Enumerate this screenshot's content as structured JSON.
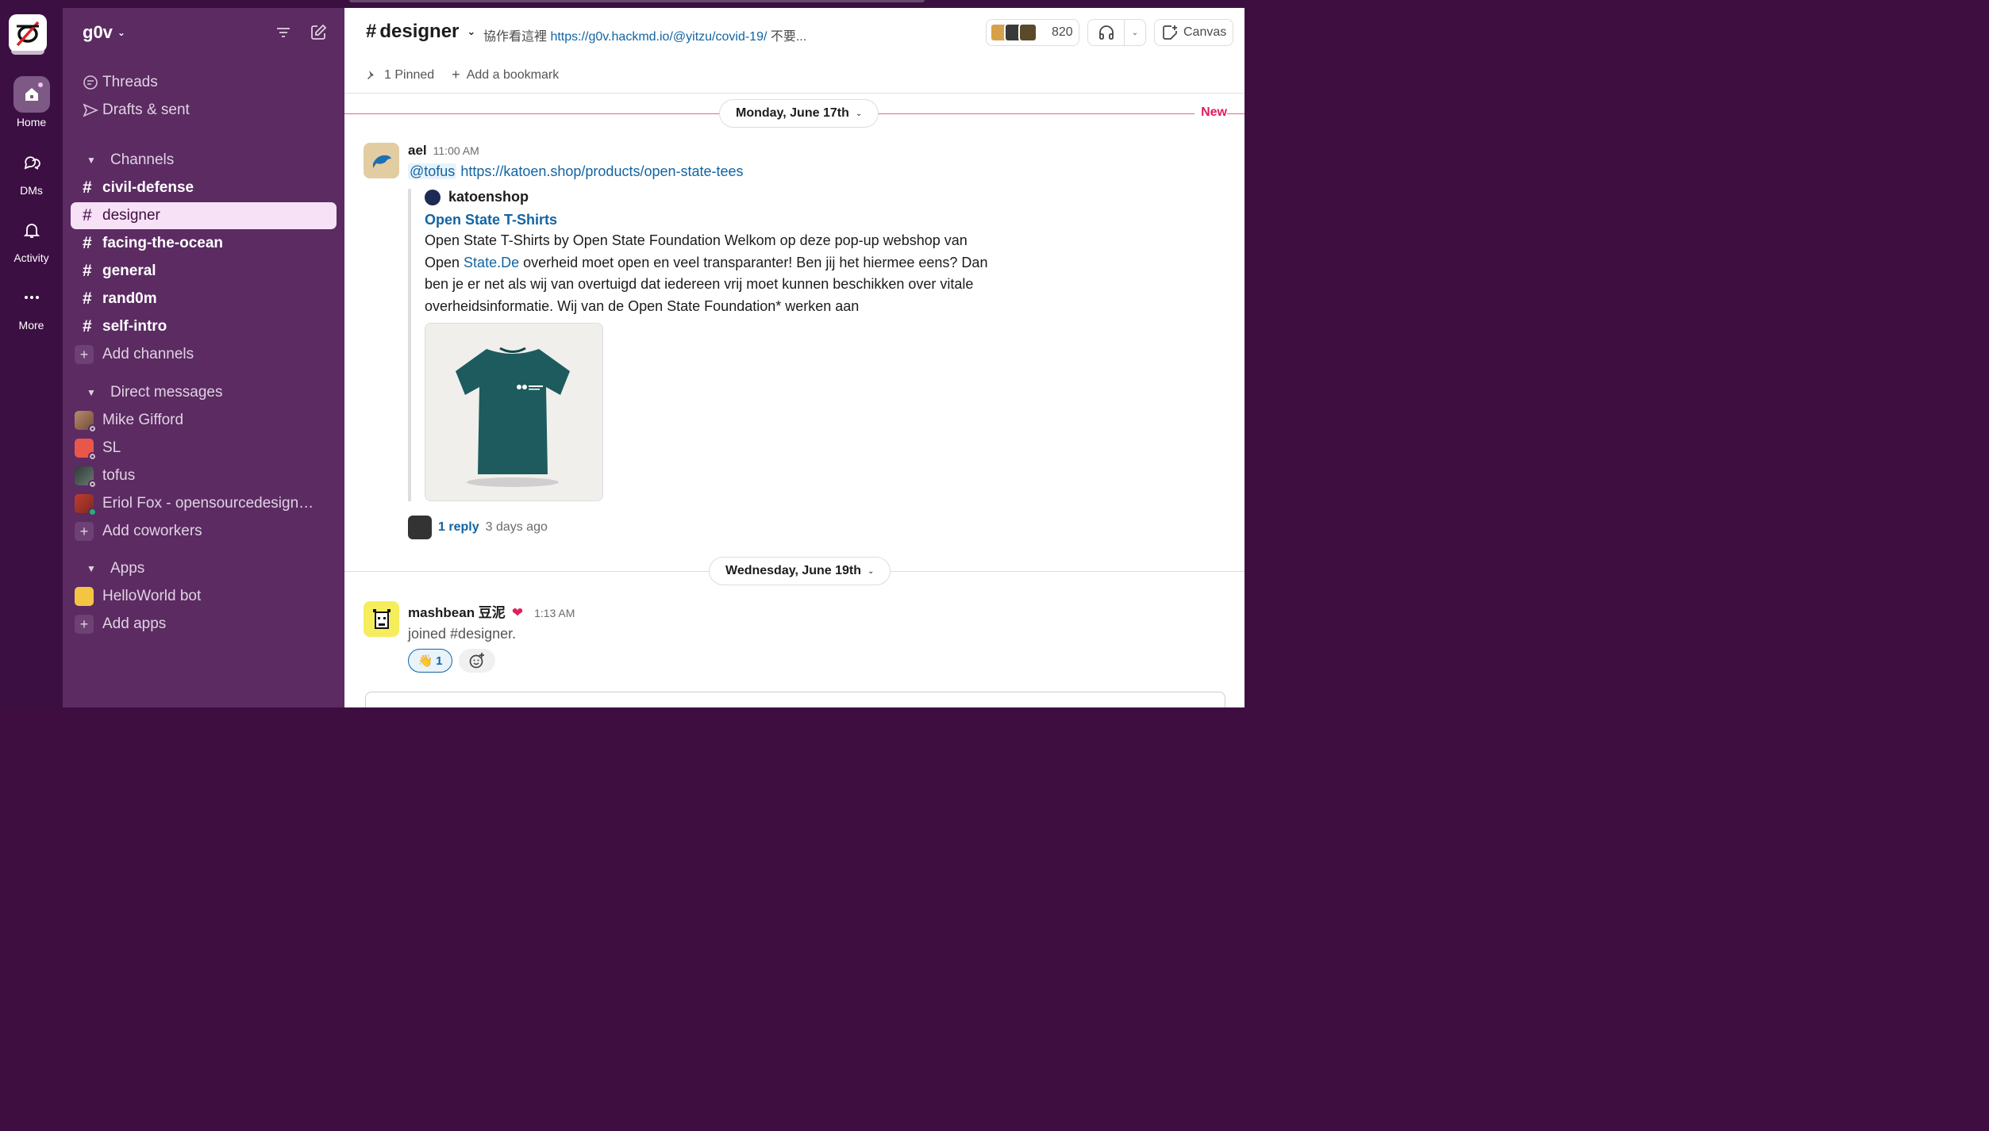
{
  "rail": {
    "items": [
      {
        "label": "Home",
        "icon": "home-icon"
      },
      {
        "label": "DMs",
        "icon": "dms-icon"
      },
      {
        "label": "Activity",
        "icon": "bell-icon"
      },
      {
        "label": "More",
        "icon": "more-icon"
      }
    ]
  },
  "sidebar": {
    "workspace": "g0v",
    "nav": [
      {
        "label": "Threads",
        "icon": "threads-icon"
      },
      {
        "label": "Drafts & sent",
        "icon": "send-icon"
      }
    ],
    "channels_header": "Channels",
    "channels": [
      {
        "name": "civil-defense",
        "bold": true
      },
      {
        "name": "designer",
        "selected": true
      },
      {
        "name": "facing-the-ocean",
        "bold": true
      },
      {
        "name": "general",
        "bold": true
      },
      {
        "name": "rand0m",
        "bold": true
      },
      {
        "name": "self-intro",
        "bold": true
      }
    ],
    "add_channels": "Add channels",
    "dm_header": "Direct messages",
    "dms": [
      {
        "name": "Mike Gifford"
      },
      {
        "name": "SL"
      },
      {
        "name": "tofus"
      },
      {
        "name": "Eriol Fox - opensourcedesign.n..."
      }
    ],
    "add_coworkers": "Add coworkers",
    "apps_header": "Apps",
    "apps": [
      {
        "name": "HelloWorld bot"
      }
    ],
    "add_apps": "Add apps"
  },
  "channel": {
    "name": "designer",
    "topic_prefix": "協作看這裡 ",
    "topic_link": "https://g0v.hackmd.io/@yitzu/covid-19/",
    "topic_suffix": " 不要...",
    "member_count": "820",
    "canvas_label": "Canvas",
    "pinned": "1 Pinned",
    "add_bookmark": "Add a bookmark"
  },
  "dividers": {
    "first": "Monday, June 17th",
    "new_label": "New",
    "second": "Wednesday, June 19th"
  },
  "messages": [
    {
      "author": "ael",
      "time": "11:00 AM",
      "mention": "@tofus",
      "link": "https://katoen.shop/products/open-state-tees",
      "unfurl": {
        "site": "katoenshop",
        "title": "Open State T-Shirts",
        "desc_1": "Open State T-Shirts by Open State Foundation Welkom op deze pop-up webshop van Open ",
        "desc_link": "State.De",
        "desc_2": " overheid moet open en veel transparanter! Ben jij het hiermee eens? Dan ben je er net als wij van overtuigd dat iedereen vrij moet kunnen beschikken over vitale overheidsinformatie. Wij van de Open State Foundation* werken aan"
      },
      "thread": {
        "replies": "1 reply",
        "ago": "3 days ago"
      }
    },
    {
      "author": "mashbean 豆泥",
      "time": "1:13 AM",
      "text": "joined #designer.",
      "reaction": {
        "emoji": "👋",
        "count": "1"
      }
    }
  ]
}
